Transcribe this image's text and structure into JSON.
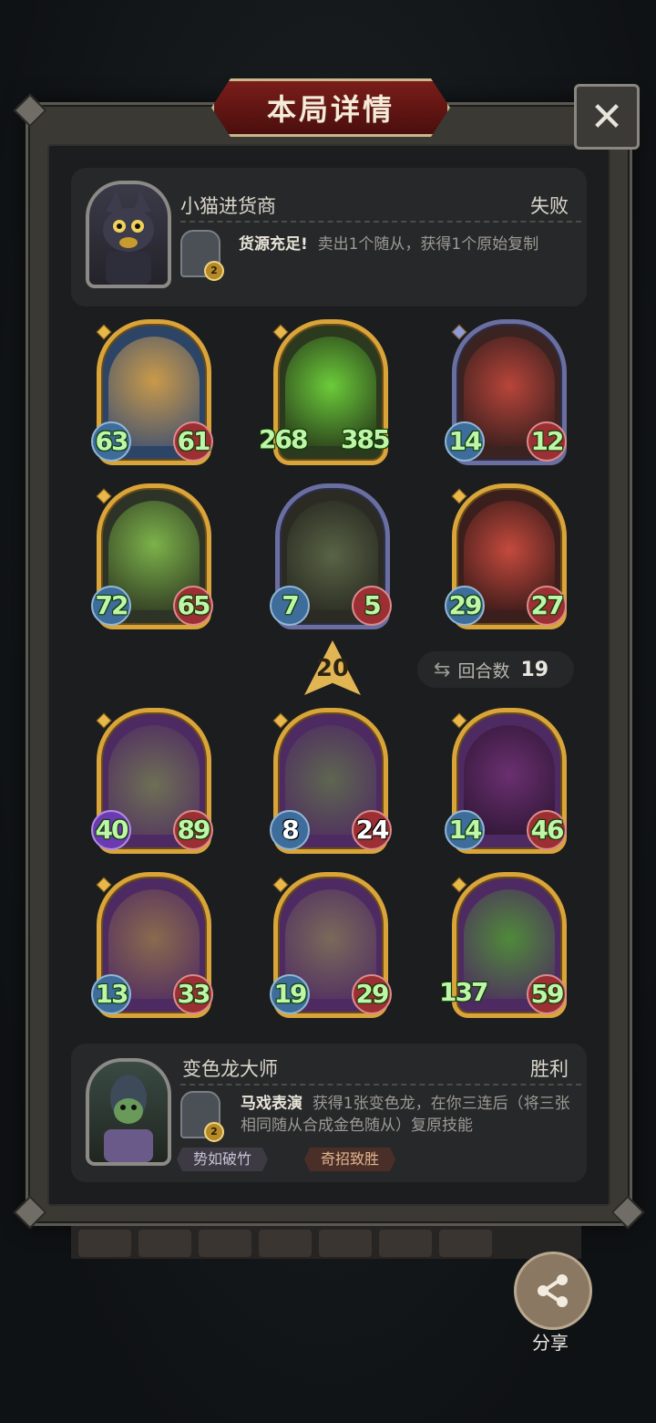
{
  "title": "本局详情",
  "close_label": "✕",
  "opponent": {
    "name": "小猫进货商",
    "result": "失败",
    "hero_level": "2",
    "skill_name": "货源充足!",
    "skill_desc": "卖出1个随从，获得1个原始复制"
  },
  "player": {
    "name": "变色龙大师",
    "result": "胜利",
    "hero_level": "2",
    "skill_name": "马戏表演",
    "skill_desc": "获得1张变色龙，在你三连后（将三张相同随从合成金色随从）复原技能",
    "tags": [
      "势如破竹",
      "奇招致胜"
    ]
  },
  "opponent_board": [
    {
      "atk": "63",
      "hp": "61",
      "frame": "gold"
    },
    {
      "atk": "268",
      "hp": "385",
      "frame": "gold"
    },
    {
      "atk": "14",
      "hp": "12",
      "frame": "silver"
    },
    {
      "atk": "72",
      "hp": "65",
      "frame": "gold"
    },
    {
      "atk": "7",
      "hp": "5",
      "frame": "silver"
    },
    {
      "atk": "29",
      "hp": "27",
      "frame": "gold"
    }
  ],
  "tavern_tier": "20",
  "round": {
    "label": "回合数",
    "value": "19"
  },
  "player_board": [
    {
      "atk": "40",
      "hp": "89",
      "frame": "gold"
    },
    {
      "atk": "8",
      "hp": "24",
      "frame": "gold"
    },
    {
      "atk": "14",
      "hp": "46",
      "frame": "gold"
    },
    {
      "atk": "13",
      "hp": "33",
      "frame": "gold"
    },
    {
      "atk": "19",
      "hp": "29",
      "frame": "gold"
    },
    {
      "atk": "137",
      "hp": "59",
      "frame": "gold"
    }
  ],
  "share_label": "分享",
  "colors": {
    "gold_frame": "#d9a43a",
    "silver_frame": "#6b6fa0",
    "stat_text": "#bff5a8",
    "banner": "#7a1d1a"
  }
}
